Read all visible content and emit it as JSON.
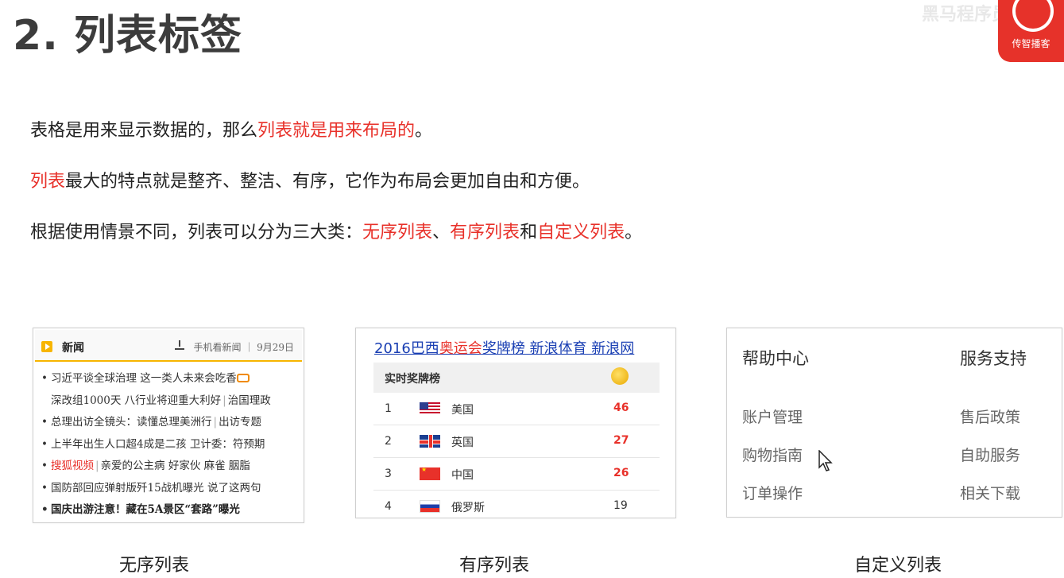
{
  "title": "2. 列表标签",
  "logo": {
    "faded_text": "黑马程序员",
    "brand_text": "传智播客"
  },
  "paragraphs": {
    "p1": {
      "pre": "表格是用来显示数据的，那么",
      "red": "列表就是用来布局的",
      "post": "。"
    },
    "p2": {
      "red": "列表",
      "post": "最大的特点就是整齐、整洁、有序，它作为布局会更加自由和方便。"
    },
    "p3": {
      "pre": "根据使用情景不同，列表可以分为三大类：",
      "red1": "无序列表",
      "mid1": "、",
      "red2": "有序列表",
      "mid2": "和",
      "red3": "自定义列表",
      "post": "。"
    }
  },
  "news": {
    "header": "新闻",
    "meta": "手机看新闻 ｜ 9月29日",
    "items": [
      {
        "text": "习近平谈全球治理 这一类人未来会吃香"
      },
      {
        "text": "深改组1000天 八行业将迎重大利好",
        "extra": "治国理政"
      },
      {
        "text": "总理出访全镜头：读懂总理美洲行",
        "extra": "出访专题"
      },
      {
        "text": "上半年出生人口超4成是二孩 卫计委：符预期"
      },
      {
        "red": "搜狐视频",
        "text": "亲爱的公主病 好家伙 麻雀 胭脂"
      },
      {
        "text": "国防部回应弹射版歼15战机曝光 说了这两句"
      },
      {
        "text": "国庆出游注意！藏在5A景区“套路”曝光"
      }
    ]
  },
  "medal": {
    "title_a": "2016巴西",
    "title_b": "奥运会",
    "title_c": "奖牌榜  新浪体育  新浪网",
    "header": "实时奖牌榜",
    "rows": [
      {
        "rank": "1",
        "country": "美国",
        "count": "46",
        "count_color": "#e8312a"
      },
      {
        "rank": "2",
        "country": "英国",
        "count": "27",
        "count_color": "#e8312a"
      },
      {
        "rank": "3",
        "country": "中国",
        "count": "26",
        "count_color": "#e8312a"
      },
      {
        "rank": "4",
        "country": "俄罗斯",
        "count": "19",
        "count_color": "#333333"
      }
    ]
  },
  "help": {
    "left_heading": "帮助中心",
    "right_heading": "服务支持",
    "left_items": [
      "账户管理",
      "购物指南",
      "订单操作"
    ],
    "right_items": [
      "售后政策",
      "自助服务",
      "相关下载"
    ]
  },
  "captions": {
    "unordered": "无序列表",
    "ordered": "有序列表",
    "definition": "自定义列表"
  }
}
